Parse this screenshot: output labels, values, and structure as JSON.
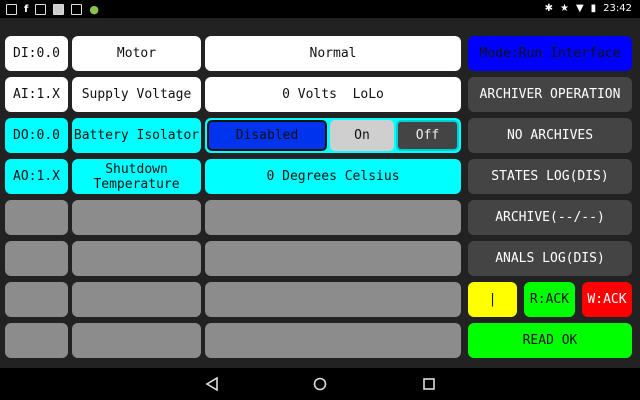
{
  "statusbar": {
    "time": "23:42",
    "left_icons": [
      "image-icon",
      "facebook-icon",
      "email-icon",
      "keyboard-icon",
      "gallery-icon",
      "android-icon"
    ],
    "right_icons": [
      "bluetooth-icon",
      "star-icon",
      "wifi-icon",
      "battery-icon"
    ]
  },
  "rows": [
    {
      "id": "DI:0.0",
      "name": "Motor",
      "value": "Normal"
    },
    {
      "id": "AI:1.X",
      "name": "Supply Voltage",
      "value": "0 Volts  LoLo"
    },
    {
      "id": "DO:0.0",
      "name": "Battery Isolator",
      "options": [
        "Disabled",
        "On",
        "Off"
      ],
      "selected": "Disabled"
    },
    {
      "id": "AO:1.X",
      "name": "Shutdown Temperature",
      "value": "0 Degrees Celsius"
    }
  ],
  "right_panel": {
    "mode": "Mode:Run Interface",
    "archiver_operation": "ARCHIVER OPERATION",
    "no_archives": "NO ARCHIVES",
    "states_log": "STATES LOG(DIS)",
    "archive": "ARCHIVE(--/--)",
    "anals_log": "ANALS LOG(DIS)",
    "indicator_yellow": "|",
    "r_ack": "R:ACK",
    "w_ack": "W:ACK",
    "read_ok": "READ OK"
  },
  "colors": {
    "white": "#ffffff",
    "cyan": "#00ffff",
    "gray": "#8c8c8c",
    "blue": "#0000ff",
    "yellow": "#ffff00",
    "green": "#00ff00",
    "red": "#ff0000"
  }
}
